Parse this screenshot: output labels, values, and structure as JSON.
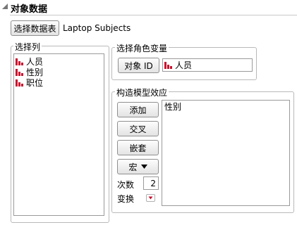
{
  "title": "对象数据",
  "data_table": {
    "button_label": "选择数据表",
    "table_name": "Laptop Subjects"
  },
  "select_columns": {
    "legend": "选择列",
    "items": [
      {
        "label": "人员",
        "icon": "continuous-column-icon"
      },
      {
        "label": "性别",
        "icon": "continuous-column-icon"
      },
      {
        "label": "职位",
        "icon": "continuous-column-icon"
      }
    ]
  },
  "role_vars": {
    "legend": "选择角色变量",
    "subject_id_button": "对象 ID",
    "subject_id_value": "人员"
  },
  "model_effects": {
    "legend": "构造模型效应",
    "add_button": "添加",
    "cross_button": "交叉",
    "nest_button": "嵌套",
    "macro_button": "宏",
    "degree_label": "次数",
    "degree_value": "2",
    "transform_label": "变换",
    "effects": [
      "性别"
    ]
  },
  "colors": {
    "icon_red": "#c8102e",
    "border": "#b9b9b9"
  }
}
